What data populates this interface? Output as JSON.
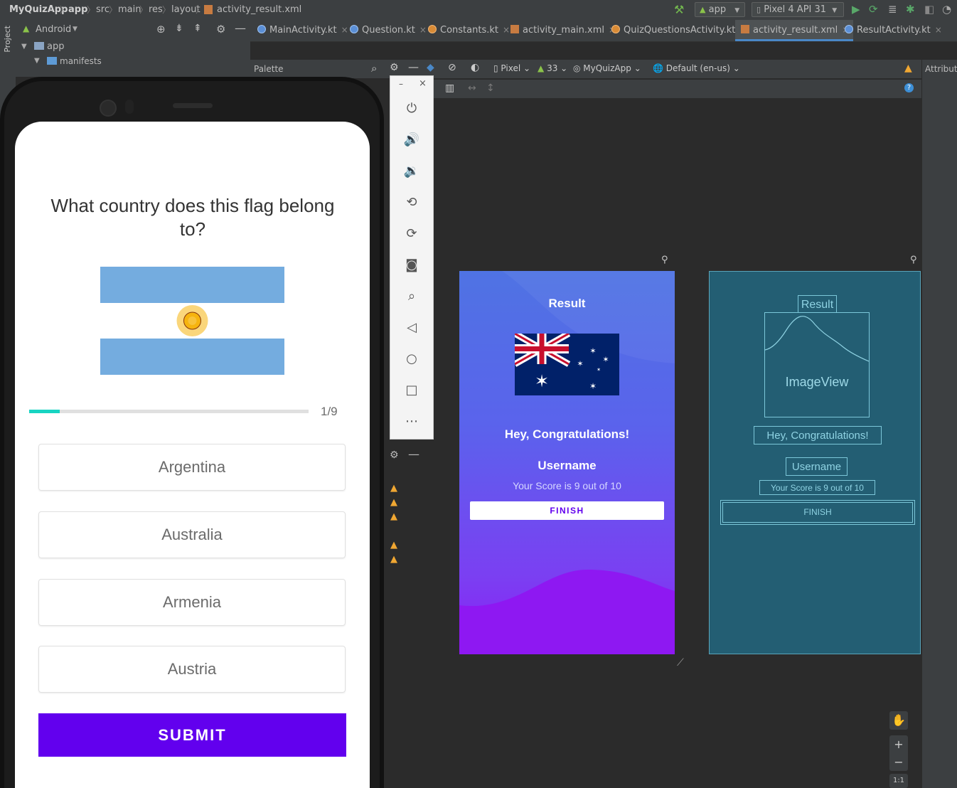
{
  "breadcrumbs": [
    "MyQuizApp",
    "app",
    "src",
    "main",
    "res",
    "layout",
    "activity_result.xml"
  ],
  "run_config": "app",
  "device": "Pixel 4 API 31",
  "project_view": "Android",
  "tree": {
    "app": "app",
    "manifests": "manifests"
  },
  "side_tab": "Project",
  "tabs": [
    {
      "label": "MainActivity.kt",
      "icon": "kotlin-file-icon"
    },
    {
      "label": "Question.kt",
      "icon": "kotlin-file-icon"
    },
    {
      "label": "Constants.kt",
      "icon": "kotlin-object-icon"
    },
    {
      "label": "activity_main.xml",
      "icon": "xml-layout-icon"
    },
    {
      "label": "QuizQuestionsActivity.kt",
      "icon": "kotlin-object-icon"
    },
    {
      "label": "activity_result.xml",
      "icon": "xml-layout-icon",
      "active": true
    },
    {
      "label": "ResultActivity.kt",
      "icon": "kotlin-file-icon"
    }
  ],
  "palette_label": "Palette",
  "attributes_label": "Attribute",
  "design_toolbar": {
    "device": "Pixel",
    "api": "33",
    "theme": "MyQuizApp",
    "locale": "Default (en-us)"
  },
  "quiz": {
    "question": "What country does this flag belong to?",
    "flag": "argentina-flag",
    "progress_text": "1/9",
    "progress": 0.11,
    "options": [
      "Argentina",
      "Australia",
      "Armenia",
      "Austria"
    ],
    "submit": "SUBMIT"
  },
  "result_preview": {
    "title": "Result",
    "flag": "australia-flag",
    "congrats": "Hey, Congratulations!",
    "username": "Username",
    "score": "Your Score is 9 out of 10",
    "finish": "FINISH"
  },
  "blueprint": {
    "title": "Result",
    "image_label": "ImageView",
    "congrats": "Hey, Congratulations!",
    "username": "Username",
    "score": "Your Score is 9 out of 10",
    "finish": "FINISH"
  },
  "zoom": {
    "fit": "1:1"
  },
  "colors": {
    "accent": "#6200ee",
    "progress": "#18d4c2",
    "preview_top": "#4f73e3",
    "preview_bottom": "#8b1cf6",
    "blueprint": "#235e73"
  }
}
